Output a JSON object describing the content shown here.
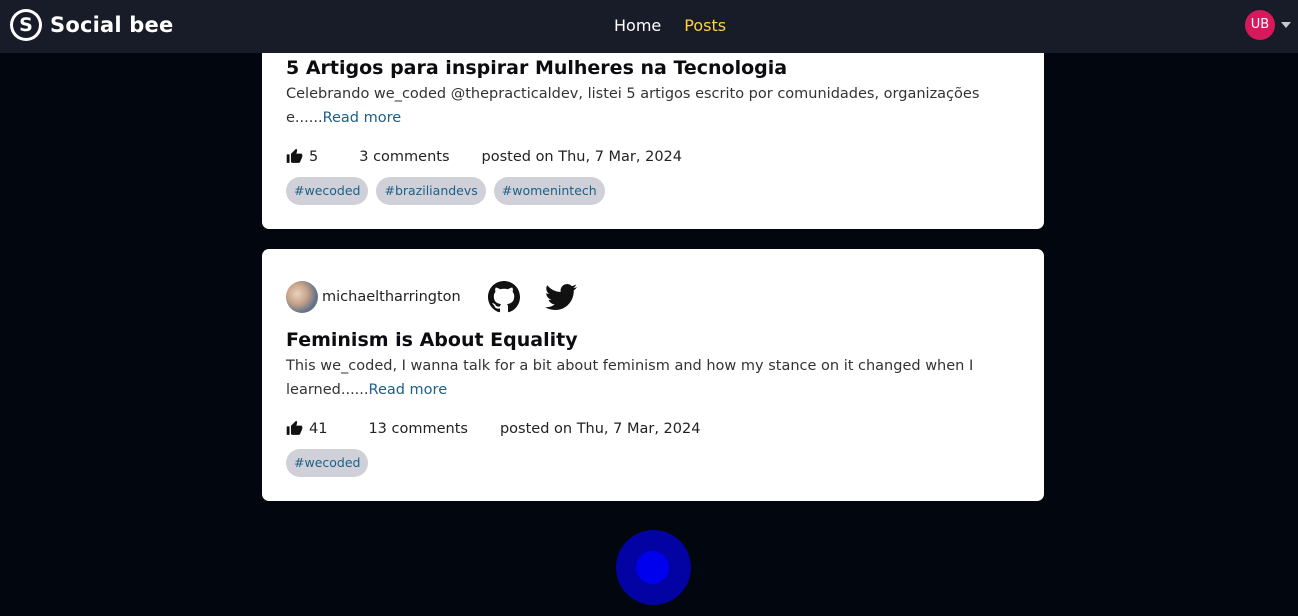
{
  "app": {
    "brand_letter": "S",
    "brand_name": "Social bee"
  },
  "nav": {
    "home": "Home",
    "posts": "Posts"
  },
  "user": {
    "initials": "UB"
  },
  "posts": [
    {
      "title": "5 Artigos para inspirar Mulheres na Tecnologia",
      "excerpt": "Celebrando we_coded @thepracticaldev, listei 5 artigos escrito por comunidades, organizações e......",
      "read_more": "Read more",
      "likes": "5",
      "comments": "3 comments",
      "posted": "posted on Thu, 7 Mar, 2024",
      "tags": [
        "#wecoded",
        "#braziliandevs",
        "#womenintech"
      ]
    },
    {
      "author": "michaeltharrington",
      "title": "Feminism is About Equality",
      "excerpt": "This we_coded, I wanna talk for a bit about feminism and how my stance on it changed when I learned......",
      "read_more": "Read more",
      "likes": "41",
      "comments": "13 comments",
      "posted": "posted on Thu, 7 Mar, 2024",
      "tags": [
        "#wecoded"
      ]
    }
  ],
  "icons": {
    "like": "thumbs-up-icon",
    "github": "github-icon",
    "twitter": "twitter-icon",
    "caret": "chevron-down-icon"
  },
  "colors": {
    "background": "#02060f",
    "navbar": "#181c28",
    "active_link": "#ffd23b",
    "avatar_badge": "#d6195b",
    "link": "#1d5f86",
    "tag_bg": "#cfd0d8",
    "loader_outer": "#0303a3",
    "loader_inner": "#0000ee"
  }
}
